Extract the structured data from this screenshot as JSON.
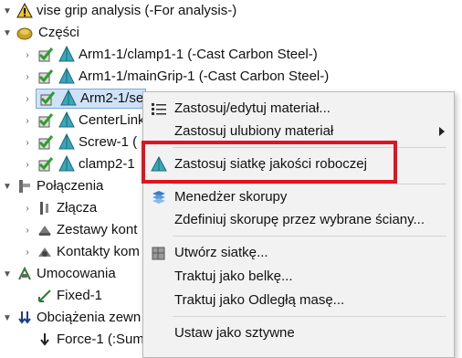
{
  "tree": {
    "root_label": "vise grip analysis (-For analysis-)",
    "parts_label": "Części",
    "parts": [
      "Arm1-1/clamp1-1 (-Cast Carbon Steel-)",
      "Arm1-1/mainGrip-1 (-Cast Carbon Steel-)",
      "Arm2-1/se",
      "CenterLink",
      "Screw-1 (",
      "clamp2-1"
    ],
    "connections_label": "Połączenia",
    "connections": [
      "Złącza",
      "Zestawy kont",
      "Kontakty kom"
    ],
    "fixtures_label": "Umocowania",
    "fixtures": [
      "Fixed-1"
    ],
    "loads_label": "Obciążenia zewn",
    "loads": [
      "Force-1 (:Sum"
    ]
  },
  "context_menu": {
    "items": [
      "Zastosuj/edytuj materiał...",
      "Zastosuj ulubiony materiał",
      "Zastosuj siatkę jakości roboczej",
      "Menedżer skorupy",
      "Zdefiniuj skorupę przez wybrane ściany...",
      "Utwórz siatkę...",
      "Traktuj jako belkę...",
      "Traktuj jako Odległą masę...",
      "Ustaw jako sztywne"
    ]
  },
  "colors": {
    "highlight_border": "#e0141e",
    "selection": "#cfe2f7",
    "part_icon": "#3aa6b9",
    "check": "#2e9e2e"
  }
}
